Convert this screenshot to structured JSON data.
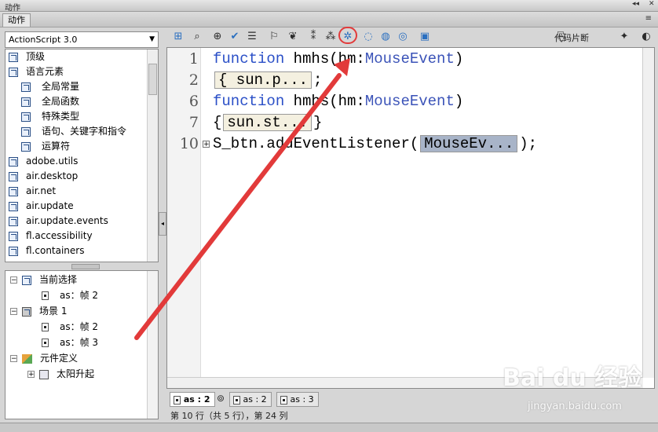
{
  "window": {
    "title": "动作",
    "controls": "◂◂ ✕"
  },
  "panel": {
    "menu": "≡"
  },
  "left": {
    "version_select": "ActionScript 3.0",
    "library": [
      {
        "label": "顶级",
        "indent": 0
      },
      {
        "label": "语言元素",
        "indent": 0
      },
      {
        "label": "全局常量",
        "indent": 1
      },
      {
        "label": "全局函数",
        "indent": 1
      },
      {
        "label": "特殊类型",
        "indent": 1
      },
      {
        "label": "语句、关键字和指令",
        "indent": 1
      },
      {
        "label": "运算符",
        "indent": 1
      },
      {
        "label": "adobe.utils",
        "indent": 0
      },
      {
        "label": "air.desktop",
        "indent": 0
      },
      {
        "label": "air.net",
        "indent": 0
      },
      {
        "label": "air.update",
        "indent": 0
      },
      {
        "label": "air.update.events",
        "indent": 0
      },
      {
        "label": "fl.accessibility",
        "indent": 0
      },
      {
        "label": "fl.containers",
        "indent": 0
      }
    ],
    "tree": {
      "current": "当前选择",
      "current_frame": "as：帧 2",
      "scene": "场景 1",
      "scene_frames": [
        "as：帧 2",
        "as：帧 3"
      ],
      "symbols": "元件定义",
      "symbol_item": "太阳升起"
    }
  },
  "toolbar": {
    "snippets_label": "代码片断"
  },
  "editor": {
    "lines": [
      {
        "num": "1",
        "kw": "function",
        "rest": " hmhs(hm:",
        "type": "MouseEvent",
        "tail": ")"
      },
      {
        "num": "2",
        "chip": "{ sun.p...",
        "after": ";"
      },
      {
        "num": "6",
        "kw": "function",
        "rest": " hmhs(hm:",
        "type": "MouseEvent",
        "tail": ")"
      },
      {
        "num": "7",
        "before": "{",
        "chip": "sun.st...",
        "after": "}"
      },
      {
        "num": "10",
        "pre": "S_btn.addEventListener(",
        "chip": "MouseEv...",
        "after": ");"
      }
    ]
  },
  "tabs": [
    {
      "label": "as : 2",
      "active": true
    },
    {
      "label": "as : 2",
      "active": false
    },
    {
      "label": "as : 3",
      "active": false
    }
  ],
  "status": "第 10 行（共 5 行），第 24 列",
  "watermark": {
    "brand": "Bai du 经验",
    "url": "jingyan.baidu.com"
  },
  "colors": {
    "keyword": "#2a4fc7",
    "highlight": "#e23a3a",
    "chip": "#f4f0e0",
    "chip_selected": "#a8b4c8"
  }
}
